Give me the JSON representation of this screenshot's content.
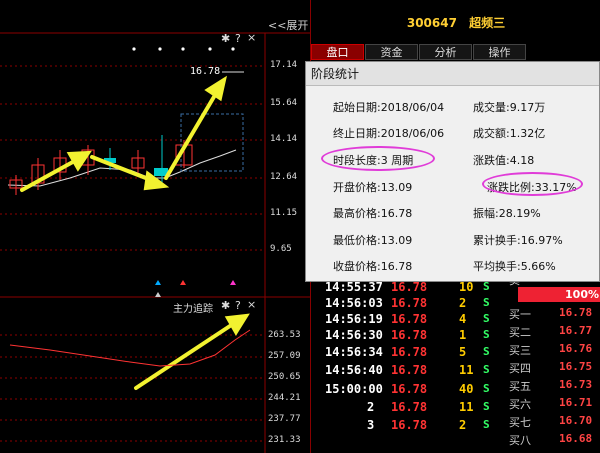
{
  "chart": {
    "expand_label": "<<展开",
    "price_ticks": [
      "17.14",
      "15.64",
      "14.14",
      "12.64",
      "11.15",
      "9.65"
    ],
    "marker_label": "16.78",
    "settings_icon": "gear-icon",
    "help_label": "?",
    "close_label": "×",
    "sub_title": "主力追踪",
    "sub_ticks": [
      "263.53",
      "257.09",
      "250.65",
      "244.21",
      "237.77",
      "231.33"
    ],
    "colors": {
      "up": "#ff3333",
      "down": "#00cccc",
      "arrow": "#f2f230",
      "grid": "#8b0000",
      "selection": "#3a6ea5"
    }
  },
  "header": {
    "code": "300647",
    "name": "超频三"
  },
  "tabs": [
    {
      "label": "盘口",
      "active": true
    },
    {
      "label": "资金",
      "active": false
    },
    {
      "label": "分析",
      "active": false
    },
    {
      "label": "操作",
      "active": false
    }
  ],
  "dialog": {
    "title": "阶段统计",
    "fields": {
      "start_date": "起始日期:2018/06/04",
      "end_date": "终止日期:2018/06/06",
      "period": "时段长度:3 周期",
      "open": "开盘价格:13.09",
      "high": "最高价格:16.78",
      "low": "最低价格:13.09",
      "close": "收盘价格:16.78",
      "volume": "成交量:9.17万",
      "amount": "成交额:1.32亿",
      "change": "涨跌值:4.18",
      "change_pct": "涨跌比例:33.17%",
      "amplitude": "振幅:28.19%",
      "cum_turnover": "累计换手:16.97%",
      "avg_turnover": "平均换手:5.66%"
    }
  },
  "trades": [
    {
      "time": "14:55:37",
      "price": "16.78",
      "vol": "10",
      "side": "S"
    },
    {
      "time": "14:56:03",
      "price": "16.78",
      "vol": "2",
      "side": "S"
    },
    {
      "time": "14:56:19",
      "price": "16.78",
      "vol": "4",
      "side": "S"
    },
    {
      "time": "14:56:30",
      "price": "16.78",
      "vol": "1",
      "side": "S"
    },
    {
      "time": "14:56:34",
      "price": "16.78",
      "vol": "5",
      "side": "S"
    },
    {
      "time": "14:56:40",
      "price": "16.78",
      "vol": "11",
      "side": "S"
    },
    {
      "time": "15:00:00",
      "price": "16.78",
      "vol": "40",
      "side": "S"
    },
    {
      "time": "2",
      "price": "16.78",
      "vol": "11",
      "side": "S"
    },
    {
      "time": "3",
      "price": "16.78",
      "vol": "2",
      "side": "S"
    }
  ],
  "orderbook": {
    "sell_label": "卖一",
    "pct": "100%",
    "bids": [
      {
        "label": "买一",
        "price": "16.78"
      },
      {
        "label": "买二",
        "price": "16.77"
      },
      {
        "label": "买三",
        "price": "16.76"
      },
      {
        "label": "买四",
        "price": "16.75"
      },
      {
        "label": "买五",
        "price": "16.73"
      },
      {
        "label": "买六",
        "price": "16.71"
      },
      {
        "label": "买七",
        "price": "16.70"
      },
      {
        "label": "买八",
        "price": "16.68"
      }
    ]
  }
}
